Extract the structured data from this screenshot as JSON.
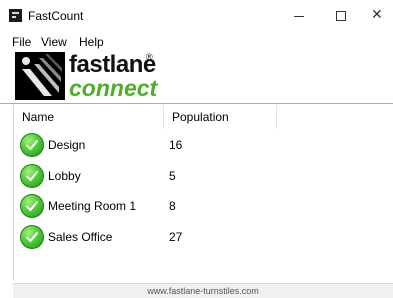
{
  "window": {
    "title": "FastCount",
    "icon": "fastcount-app-icon",
    "controls": {
      "minimize": "─",
      "maximize": "□",
      "close": "✕"
    }
  },
  "menu": {
    "file": "File",
    "view": "View",
    "help": "Help"
  },
  "logo": {
    "word1": "fastlane",
    "word2": "connect",
    "reg": "®",
    "accent": "#4caf2a"
  },
  "table": {
    "headers": {
      "name": "Name",
      "population": "Population"
    },
    "rows": [
      {
        "name": "Design",
        "population": "16",
        "status_icon": "green-check-icon"
      },
      {
        "name": "Lobby",
        "population": "5",
        "status_icon": "green-check-icon"
      },
      {
        "name": "Meeting Room 1",
        "population": "8",
        "status_icon": "green-check-icon"
      },
      {
        "name": "Sales Office",
        "population": "27",
        "status_icon": "green-check-icon"
      }
    ]
  },
  "footer": {
    "url": "www.fastlane-turnstiles.com"
  }
}
